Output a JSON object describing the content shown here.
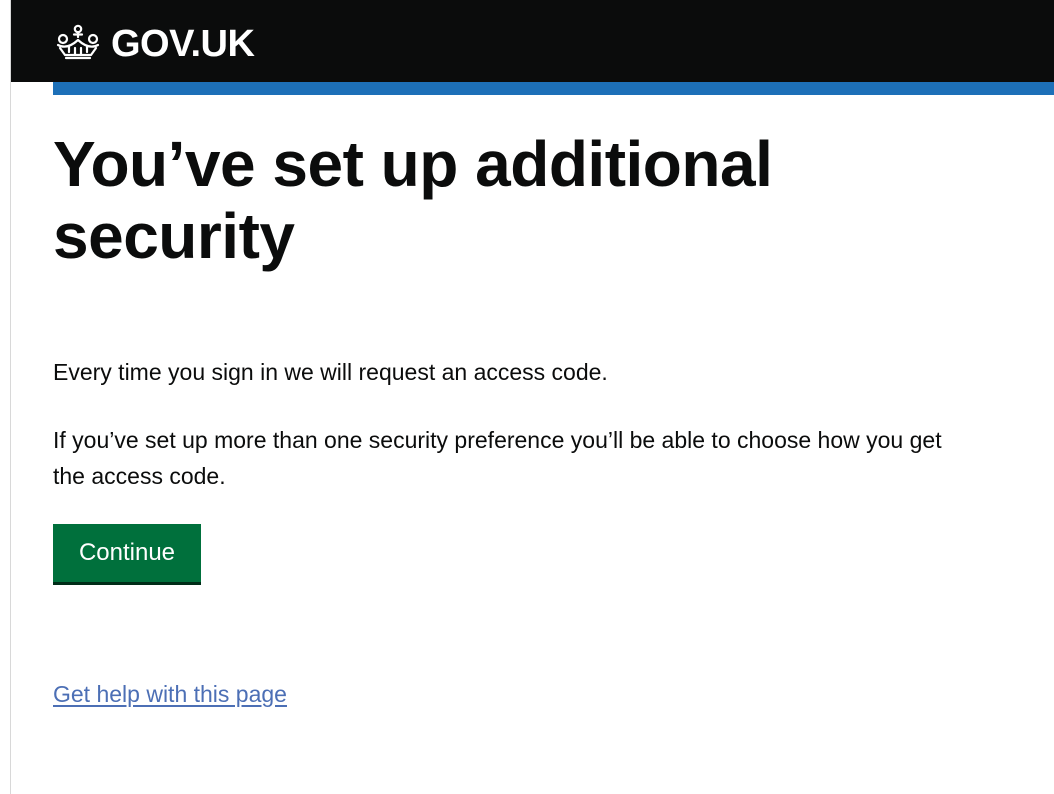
{
  "header": {
    "logo_text": "GOV.UK",
    "logo_icon": "crown-icon",
    "colors": {
      "background": "#0b0c0c",
      "accent_bar": "#1d70b8"
    }
  },
  "main": {
    "title": "You’ve set up additional security",
    "paragraphs": [
      "Every time you sign in we will request an access code.",
      "If you’ve set up more than one security preference you’ll be able to choose how you get the access code."
    ],
    "continue_button": {
      "label": "Continue",
      "color": "#00703c"
    },
    "help_link": {
      "label": "Get help with this page",
      "color": "#4c6fb5"
    }
  }
}
